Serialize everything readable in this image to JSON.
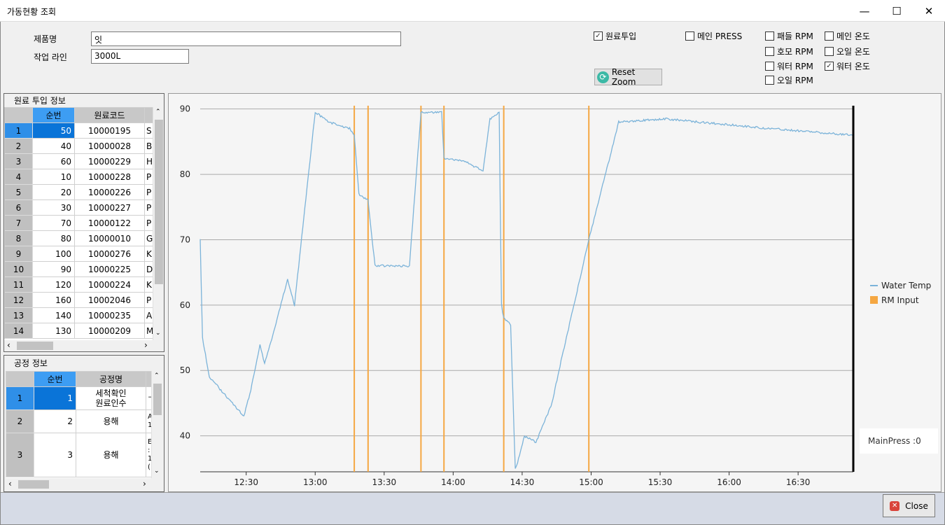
{
  "window": {
    "title": "가동현황 조회",
    "minimize": "—",
    "maximize": "☐",
    "close": "✕"
  },
  "form": {
    "product_label": "제품명",
    "product_value": "잇",
    "line_label": "작업 라인",
    "line_value": "3000L"
  },
  "checkboxes": [
    {
      "label": "원료투입",
      "checked": true
    },
    {
      "label": "메인 PRESS",
      "checked": false
    },
    {
      "label": "패들 RPM",
      "checked": false
    },
    {
      "label": "호모 RPM",
      "checked": false
    },
    {
      "label": "워터 RPM",
      "checked": false
    },
    {
      "label": "오일 RPM",
      "checked": false
    },
    {
      "label": "메인 온도",
      "checked": false
    },
    {
      "label": "오일 온도",
      "checked": false
    },
    {
      "label": "워터 온도",
      "checked": true
    }
  ],
  "reset_zoom": "Reset Zoom",
  "material": {
    "title": "원료 투입 정보",
    "headers": [
      "순번",
      "원료코드"
    ],
    "rows": [
      [
        "1",
        "50",
        "10000195",
        "S"
      ],
      [
        "2",
        "40",
        "10000028",
        "B"
      ],
      [
        "3",
        "60",
        "10000229",
        "H"
      ],
      [
        "4",
        "10",
        "10000228",
        "P"
      ],
      [
        "5",
        "20",
        "10000226",
        "P"
      ],
      [
        "6",
        "30",
        "10000227",
        "P"
      ],
      [
        "7",
        "70",
        "10000122",
        "P"
      ],
      [
        "8",
        "80",
        "10000010",
        "G"
      ],
      [
        "9",
        "100",
        "10000276",
        "K"
      ],
      [
        "10",
        "90",
        "10000225",
        "D"
      ],
      [
        "11",
        "120",
        "10000224",
        "K"
      ],
      [
        "12",
        "160",
        "10002046",
        "P"
      ],
      [
        "13",
        "140",
        "10000235",
        "A"
      ],
      [
        "14",
        "130",
        "10000209",
        "M"
      ]
    ]
  },
  "process": {
    "title": "공정 정보",
    "headers": [
      "순번",
      "공정명"
    ],
    "rows": [
      [
        "1",
        "1",
        "세척확인\n원료인수",
        "¬"
      ],
      [
        "2",
        "2",
        "용해",
        "A\n1"
      ],
      [
        "3",
        "3",
        "용해",
        "E\n:\n1\n("
      ]
    ]
  },
  "chart_data": {
    "type": "line",
    "xlim": [
      "12:10",
      "16:54"
    ],
    "ylim": [
      34.5,
      90.5
    ],
    "x_ticks": [
      "12:30",
      "13:00",
      "13:30",
      "14:00",
      "14:30",
      "15:00",
      "15:30",
      "16:00",
      "16:30"
    ],
    "y_ticks": [
      40,
      50,
      60,
      70,
      80,
      90
    ],
    "grid": true,
    "legend_position": "right",
    "series": [
      {
        "name": "Water Temp",
        "color": "#7bb3d9",
        "x": [
          "12:10",
          "12:11",
          "12:14",
          "12:29",
          "12:32",
          "12:36",
          "12:38",
          "12:42",
          "12:48",
          "12:51",
          "13:00",
          "13:06",
          "13:15",
          "13:17",
          "13:19",
          "13:23",
          "13:26",
          "13:41",
          "13:46",
          "13:55",
          "13:56",
          "14:05",
          "14:13",
          "14:16",
          "14:20",
          "14:21",
          "14:22",
          "14:25",
          "14:27",
          "14:28",
          "14:31",
          "14:36",
          "14:43",
          "14:46",
          "14:59",
          "15:12",
          "15:32",
          "15:47",
          "16:18",
          "16:54"
        ],
        "y": [
          70,
          55,
          49,
          43,
          47,
          54,
          51,
          56,
          64,
          60,
          89.5,
          88,
          87,
          86,
          77,
          76,
          66,
          66,
          89.5,
          89.5,
          82.5,
          82,
          80.5,
          88.5,
          89.5,
          60,
          58,
          57,
          35,
          36,
          40,
          39,
          45,
          50,
          70,
          88,
          88.5,
          88,
          87,
          86
        ]
      },
      {
        "name": "RM Input",
        "color": "#f5a742",
        "x": [
          "13:17",
          "13:23",
          "13:46",
          "13:56",
          "14:22",
          "14:59"
        ]
      }
    ]
  },
  "main_press": "MainPress :0",
  "close_button": "Close"
}
